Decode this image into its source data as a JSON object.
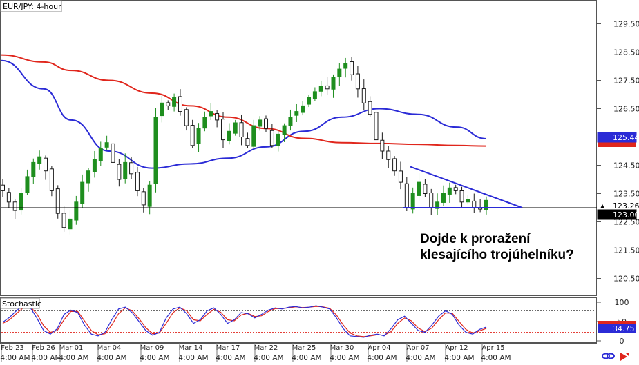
{
  "title": "EUR/JPY: 4-hour",
  "annotation": {
    "line1": "Dojde k proražení",
    "line2": "klesajícího trojúhelníku?"
  },
  "price_axis": {
    "ticks": [
      "129.50",
      "128.50",
      "127.50",
      "126.50",
      "124.50",
      "123.50",
      "122.50",
      "121.50",
      "120.50"
    ],
    "badges": [
      {
        "text": "125.44",
        "bg": "#2b2bd6",
        "fg": "#ffffff"
      },
      {
        "text": "123.26",
        "bg": "#ffffff",
        "fg": "#000000"
      },
      {
        "text": "123.00",
        "bg": "#000000",
        "fg": "#ffffff"
      }
    ]
  },
  "stochastic": {
    "label": "Stochastic",
    "ticks": [
      "100",
      "50",
      "0"
    ],
    "badge_value": "34.75",
    "badge_bg": "#2b2bd6"
  },
  "date_labels": [
    "Feb 23",
    "Feb 26",
    "Mar 01",
    "Mar 04",
    "Mar 09",
    "Mar 14",
    "Mar 17",
    "Mar 22",
    "Mar 25",
    "Mar 30",
    "Apr 04",
    "Apr 07",
    "Apr 12",
    "Apr 15"
  ],
  "time_label": "4:00 AM",
  "colors": {
    "up_candle": "#1e8e1e",
    "down_candle": "#1a1a1a",
    "ma_blue": "#2b2bd6",
    "ma_red": "#e0261c",
    "stoch_k": "#2b2bd6",
    "stoch_d": "#e0261c",
    "support": "#000000",
    "trendline": "#2b2bd6",
    "logo": "#e0261c"
  },
  "icons": {
    "link": "link-icon",
    "logo": "fxcm-logo-icon"
  },
  "chart_data": {
    "type": "candlestick",
    "title": "EUR/JPY: 4-hour",
    "ylim": [
      120.0,
      130.0
    ],
    "support_level": 123.0,
    "trendline": {
      "start": {
        "x": "Apr 05",
        "y": 124.45
      },
      "end": {
        "x": "Apr 15",
        "y": 123.0
      }
    },
    "series": [
      {
        "name": "blue moving average",
        "points": [
          [
            "Feb 23",
            128.2
          ],
          [
            "Feb 26",
            127.2
          ],
          [
            "Mar 01",
            126.1
          ],
          [
            "Mar 04",
            125.0
          ],
          [
            "Mar 09",
            124.4
          ],
          [
            "Mar 14",
            124.55
          ],
          [
            "Mar 17",
            124.75
          ],
          [
            "Mar 22",
            125.15
          ],
          [
            "Mar 25",
            125.7
          ],
          [
            "Mar 30",
            126.2
          ],
          [
            "Apr 04",
            126.5
          ],
          [
            "Apr 07",
            126.3
          ],
          [
            "Apr 12",
            125.85
          ],
          [
            "Apr 15",
            125.44
          ]
        ]
      },
      {
        "name": "red moving average",
        "points": [
          [
            "Feb 23",
            128.4
          ],
          [
            "Feb 26",
            128.15
          ],
          [
            "Mar 01",
            127.85
          ],
          [
            "Mar 04",
            127.5
          ],
          [
            "Mar 09",
            127.05
          ],
          [
            "Mar 14",
            126.6
          ],
          [
            "Mar 17",
            126.2
          ],
          [
            "Mar 22",
            125.8
          ],
          [
            "Mar 25",
            125.45
          ],
          [
            "Mar 30",
            125.3
          ],
          [
            "Apr 04",
            125.27
          ],
          [
            "Apr 07",
            125.24
          ],
          [
            "Apr 12",
            125.2
          ],
          [
            "Apr 15",
            125.18
          ]
        ]
      }
    ],
    "candles_close": [
      123.6,
      123.2,
      122.9,
      123.5,
      124.1,
      124.6,
      124.8,
      124.3,
      123.6,
      122.8,
      122.3,
      122.6,
      123.2,
      123.9,
      124.3,
      124.7,
      125.1,
      125.3,
      124.6,
      124.0,
      124.6,
      124.2,
      123.6,
      123.1,
      123.8,
      126.2,
      126.7,
      126.6,
      126.9,
      126.4,
      125.9,
      125.2,
      125.8,
      126.2,
      126.4,
      126.1,
      125.4,
      125.7,
      126.0,
      125.5,
      125.2,
      125.9,
      126.1,
      125.8,
      125.2,
      125.6,
      125.9,
      126.2,
      126.4,
      126.6,
      126.9,
      127.1,
      127.3,
      127.2,
      127.6,
      127.9,
      128.1,
      127.7,
      127.2,
      126.7,
      126.3,
      125.4,
      125.0,
      124.7,
      124.3,
      123.9,
      123.0,
      123.5,
      123.9,
      123.5,
      123.0,
      123.2,
      123.5,
      123.7,
      123.6,
      123.2,
      123.3,
      123.0,
      122.95,
      123.26
    ],
    "stochastic": {
      "k": [
        48,
        62,
        80,
        95,
        90,
        60,
        25,
        15,
        30,
        70,
        82,
        75,
        40,
        15,
        10,
        20,
        55,
        85,
        90,
        75,
        50,
        25,
        12,
        20,
        60,
        85,
        90,
        72,
        45,
        55,
        80,
        88,
        70,
        45,
        55,
        75,
        72,
        60,
        70,
        82,
        88,
        85,
        90,
        92,
        88,
        90,
        94,
        90,
        85,
        60,
        30,
        10,
        8,
        6,
        12,
        15,
        10,
        30,
        55,
        65,
        45,
        25,
        20,
        40,
        65,
        80,
        70,
        40,
        20,
        15,
        28,
        34.75
      ],
      "d": [
        45,
        55,
        72,
        88,
        92,
        72,
        38,
        20,
        25,
        55,
        78,
        78,
        52,
        25,
        13,
        16,
        40,
        72,
        88,
        80,
        58,
        33,
        16,
        18,
        45,
        75,
        88,
        80,
        55,
        52,
        70,
        84,
        76,
        55,
        52,
        68,
        73,
        64,
        66,
        78,
        86,
        86,
        88,
        91,
        89,
        90,
        92,
        91,
        87,
        68,
        40,
        18,
        10,
        8,
        10,
        13,
        12,
        22,
        45,
        60,
        52,
        32,
        22,
        32,
        55,
        74,
        73,
        50,
        28,
        18,
        24,
        31
      ]
    }
  }
}
